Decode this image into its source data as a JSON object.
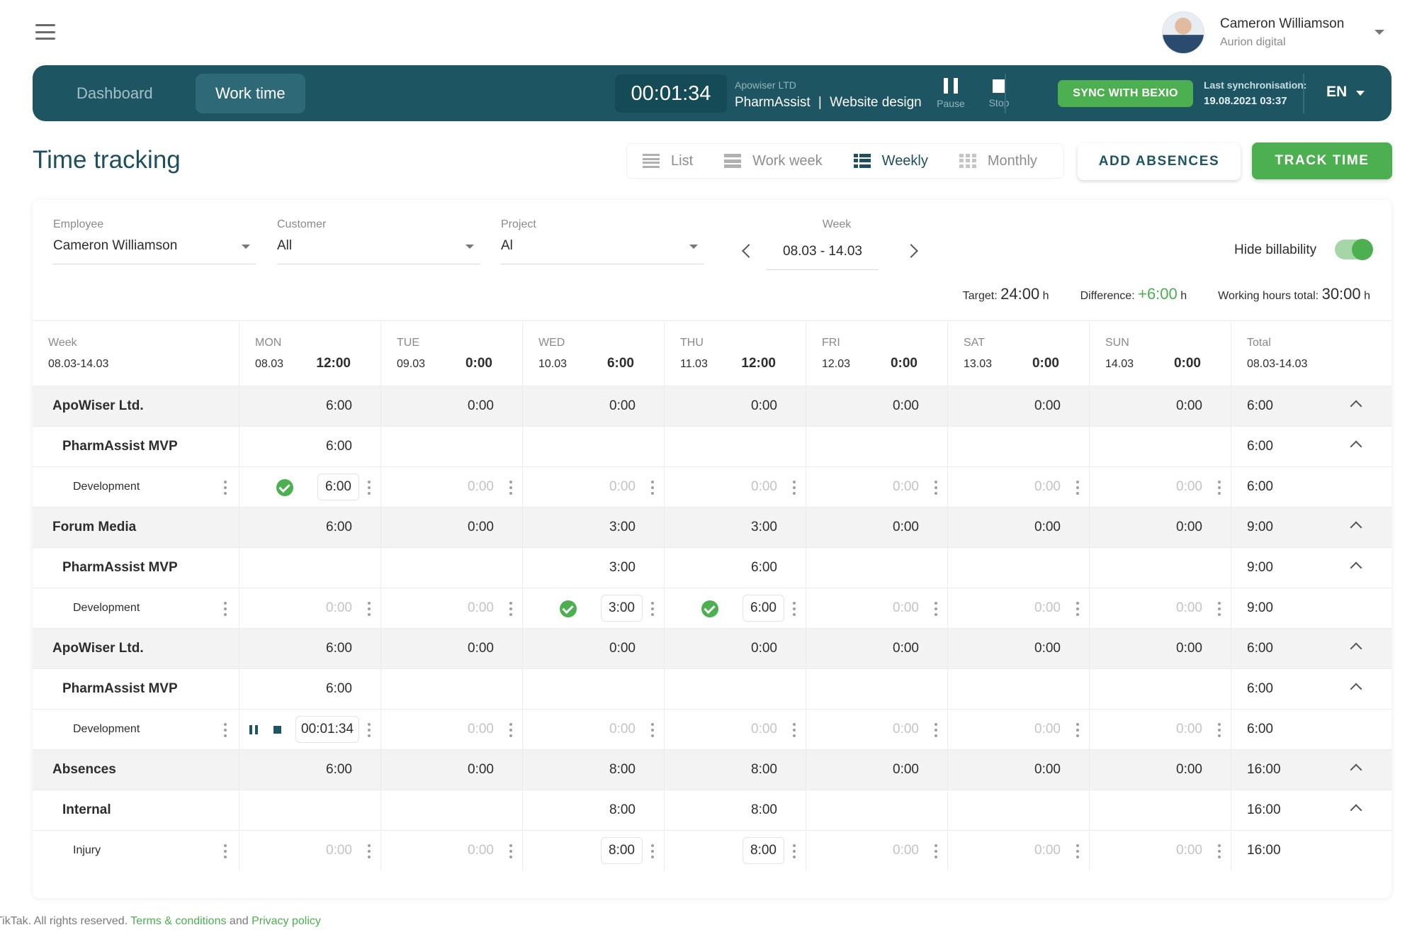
{
  "topbar": {
    "menu_icon": "hamburger-menu-icon",
    "user": {
      "name": "Cameron Williamson",
      "company": "Aurion digital"
    }
  },
  "nav": {
    "tabs": [
      {
        "label": "Dashboard"
      },
      {
        "label": "Work time"
      }
    ],
    "timer": "00:01:34",
    "task_company": "Apowiser LTD",
    "task_project": "PharmAssist",
    "task_separator": "|",
    "task_title": "Website design",
    "pause_label": "Pause",
    "stop_label": "Stop",
    "sync_button": "SYNC WITH BEXIO",
    "sync_title": "Last synchronisation:",
    "sync_time": "19.08.2021 03:37",
    "language": "EN"
  },
  "page": {
    "title": "Time tracking",
    "views": [
      {
        "label": "List",
        "icon": "list-view-icon"
      },
      {
        "label": "Work week",
        "icon": "work-week-view-icon"
      },
      {
        "label": "Weekly",
        "icon": "weekly-view-icon"
      },
      {
        "label": "Monthly",
        "icon": "monthly-view-icon"
      }
    ],
    "active_view": "Weekly",
    "add_absences": "ADD ABSENCES",
    "track_time": "TRACK TIME"
  },
  "filters": {
    "employee": {
      "label": "Employee",
      "value": "Cameron Williamson"
    },
    "customer": {
      "label": "Customer",
      "value": "All"
    },
    "project": {
      "label": "Project",
      "value": "Al"
    },
    "week": {
      "label": "Week",
      "value": "08.03 - 14.03"
    },
    "hide_billability": {
      "label": "Hide billability",
      "on": true
    }
  },
  "summary": {
    "target_label": "Target:",
    "target_value": "24:00",
    "target_unit": "h",
    "difference_label": "Difference:",
    "difference_value": "+6:00",
    "difference_unit": "h",
    "total_label": "Working hours total:",
    "total_value": "30:00",
    "total_unit": "h"
  },
  "grid": {
    "header": {
      "week_label": "Week",
      "week_range": "08.03-14.03",
      "days": [
        {
          "day": "MON",
          "date": "08.03",
          "total": "12:00"
        },
        {
          "day": "TUE",
          "date": "09.03",
          "total": "0:00"
        },
        {
          "day": "WED",
          "date": "10.03",
          "total": "6:00"
        },
        {
          "day": "THU",
          "date": "11.03",
          "total": "12:00"
        },
        {
          "day": "FRI",
          "date": "12.03",
          "total": "0:00"
        },
        {
          "day": "SAT",
          "date": "13.03",
          "total": "0:00"
        },
        {
          "day": "SUN",
          "date": "14.03",
          "total": "0:00"
        }
      ],
      "total_label": "Total",
      "total_range": "08.03-14.03"
    },
    "rows": [
      {
        "level": 0,
        "label": "ApoWiser Ltd.",
        "cells": [
          "6:00",
          "0:00",
          "0:00",
          "0:00",
          "0:00",
          "0:00",
          "0:00"
        ],
        "total": "6:00"
      },
      {
        "level": 1,
        "label": "PharmAssist MVP",
        "cells": [
          "6:00",
          "",
          "",
          "",
          "",
          "",
          ""
        ],
        "total": "6:00"
      },
      {
        "level": 2,
        "label": "Development",
        "cells": [
          {
            "value": "6:00",
            "state": "approved"
          },
          {
            "value": "0:00"
          },
          {
            "value": "0:00"
          },
          {
            "value": "0:00"
          },
          {
            "value": "0:00"
          },
          {
            "value": "0:00"
          },
          {
            "value": "0:00"
          }
        ],
        "total": "6:00"
      },
      {
        "level": 0,
        "label": "Forum Media",
        "cells": [
          "6:00",
          "0:00",
          "3:00",
          "3:00",
          "0:00",
          "0:00",
          "0:00"
        ],
        "total": "9:00"
      },
      {
        "level": 1,
        "label": "PharmAssist MVP",
        "cells": [
          "",
          "",
          "3:00",
          "6:00",
          "",
          "",
          ""
        ],
        "total": "9:00"
      },
      {
        "level": 2,
        "label": "Development",
        "cells": [
          {
            "value": "0:00"
          },
          {
            "value": "0:00"
          },
          {
            "value": "3:00",
            "state": "approved"
          },
          {
            "value": "6:00",
            "state": "approved"
          },
          {
            "value": "0:00"
          },
          {
            "value": "0:00"
          },
          {
            "value": "0:00"
          }
        ],
        "total": "9:00"
      },
      {
        "level": 0,
        "label": "ApoWiser Ltd.",
        "cells": [
          "6:00",
          "0:00",
          "0:00",
          "0:00",
          "0:00",
          "0:00",
          "0:00"
        ],
        "total": "6:00"
      },
      {
        "level": 1,
        "label": "PharmAssist MVP",
        "cells": [
          "6:00",
          "",
          "",
          "",
          "",
          "",
          ""
        ],
        "total": "6:00"
      },
      {
        "level": 2,
        "label": "Development",
        "cells": [
          {
            "value": "00:01:34",
            "state": "running"
          },
          {
            "value": "0:00"
          },
          {
            "value": "0:00"
          },
          {
            "value": "0:00"
          },
          {
            "value": "0:00"
          },
          {
            "value": "0:00"
          },
          {
            "value": "0:00"
          }
        ],
        "total": "6:00"
      },
      {
        "level": 0,
        "label": "Absences",
        "cells": [
          "6:00",
          "0:00",
          "8:00",
          "8:00",
          "0:00",
          "0:00",
          "0:00"
        ],
        "total": "16:00"
      },
      {
        "level": 1,
        "label": "Internal",
        "cells": [
          "",
          "",
          "8:00",
          "8:00",
          "",
          "",
          ""
        ],
        "total": "16:00"
      },
      {
        "level": 2,
        "label": "Injury",
        "cells": [
          {
            "value": "0:00"
          },
          {
            "value": "0:00"
          },
          {
            "value": "8:00",
            "state": "filled"
          },
          {
            "value": "8:00",
            "state": "filled"
          },
          {
            "value": "0:00"
          },
          {
            "value": "0:00"
          },
          {
            "value": "0:00"
          }
        ],
        "total": "16:00"
      }
    ]
  },
  "footer": {
    "copyright": "TikTak. All rights reserved.",
    "terms": "Terms & conditions",
    "and": "and",
    "privacy": "Privacy policy"
  },
  "colors": {
    "navbar": "#1d5563",
    "accent_green": "#4caf50",
    "title": "#1d4f5c"
  }
}
